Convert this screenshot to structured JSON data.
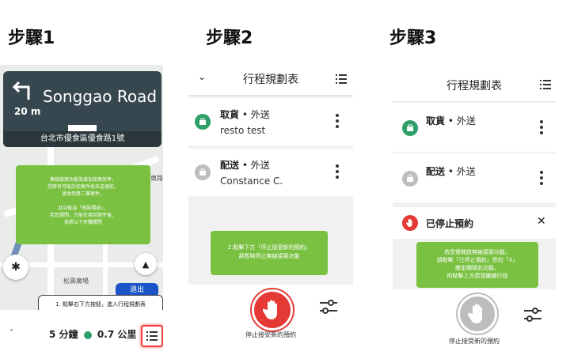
{
  "steps": {
    "step1": "步驟1",
    "step2": "步驟2",
    "step3": "步驟3"
  },
  "panel1": {
    "nav": {
      "distance": "20 m",
      "road_name": "Songgao Road",
      "street": "台北市優食區優食路1號"
    },
    "note": "無線接案功能為增加接案效率，\n您將有可能於前案件尚未送達前，\n接收到第二筆案件。\n\n此功能為「預設開啟」，\n若您關閉，只能在接到案件後，\n依照以下步驟關閉",
    "instruction": "1. 點擊右下方按鈕，進入行程規劃表",
    "exit_label": "退出",
    "eta_time": "5 分鐘",
    "eta_distance": "0.7 公里",
    "map_label": "松壽廣場",
    "map_label2": "東路"
  },
  "panel2": {
    "title": "行程規劃表",
    "cards": [
      {
        "type": "取貨",
        "sep": " • ",
        "mode": "外送",
        "name": "resto test"
      },
      {
        "type": "配送",
        "sep": " • ",
        "mode": "外送",
        "name": "Constance C."
      }
    ],
    "note": "2.點擊下方「停止接受新的預約」\n將暫時停止無線接案功能",
    "stop_label": "停止接受新的預約"
  },
  "panel3": {
    "title": "行程規劃表",
    "cards": [
      {
        "type": "取貨",
        "sep": " • ",
        "mode": "外送"
      },
      {
        "type": "配送",
        "sep": " • ",
        "mode": "外送"
      }
    ],
    "stopped_label": "已停止預約",
    "note": "若您需開啟無線接案功能，\n請點擊「已停止預約」旁的「X」\n確定關閉此功能，\n則點擊上方箭頭繼續行程",
    "stop_label": "停止接受新的預約"
  },
  "colors": {
    "green": "#7ac142",
    "pickup": "#2f9e69",
    "stop_red": "#e53935",
    "nav_dark": "#37474f"
  }
}
